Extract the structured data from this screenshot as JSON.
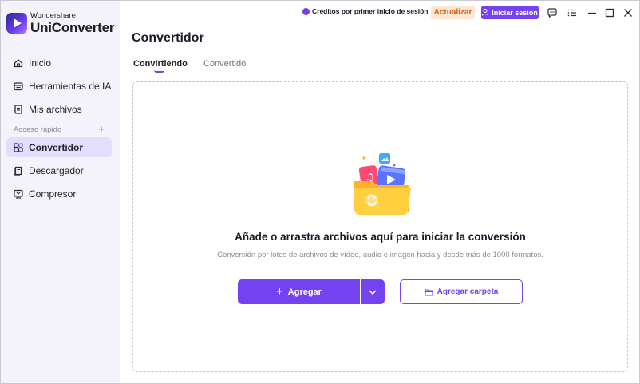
{
  "brand": {
    "company": "Wondershare",
    "product": "UniConverter"
  },
  "sidebar": {
    "items": [
      {
        "label": "Inicio",
        "icon": "home-icon"
      },
      {
        "label": "Herramientas de IA",
        "icon": "ai-tools-icon"
      },
      {
        "label": "Mis archivos",
        "icon": "files-icon"
      }
    ],
    "quick_access_label": "Acceso rápido",
    "quick_access_add": "+",
    "quick_items": [
      {
        "label": "Convertidor",
        "icon": "converter-icon",
        "active": true
      },
      {
        "label": "Descargador",
        "icon": "downloader-icon",
        "active": false
      },
      {
        "label": "Compresor",
        "icon": "compressor-icon",
        "active": false
      }
    ]
  },
  "topbar": {
    "credits_text": "Créditos por primer inicio de sesión",
    "upgrade_label": "Actualizar",
    "login_label": "Iniciar sesión",
    "icons": [
      "chat-icon",
      "menu-icon",
      "minimize-icon",
      "maximize-icon",
      "close-icon"
    ]
  },
  "main": {
    "title": "Convertidor",
    "tabs": [
      {
        "label": "Convirtiendo",
        "active": true
      },
      {
        "label": "Convertido",
        "active": false
      }
    ],
    "drop_title": "Añade o arrastra archivos aquí para iniciar la conversión",
    "drop_subtitle": "Conversión por lotes de archivos de vídeo, audio e imagen hacia y desde más de 1000 formatos.",
    "add_button": "Agregar",
    "add_folder_button": "Agregar carpeta"
  },
  "colors": {
    "accent": "#7442ee",
    "sidebar_bg": "#f4f3fb",
    "active_item_bg": "#e3defb",
    "upgrade_bg": "#fde6d3",
    "upgrade_text": "#d9641b"
  }
}
